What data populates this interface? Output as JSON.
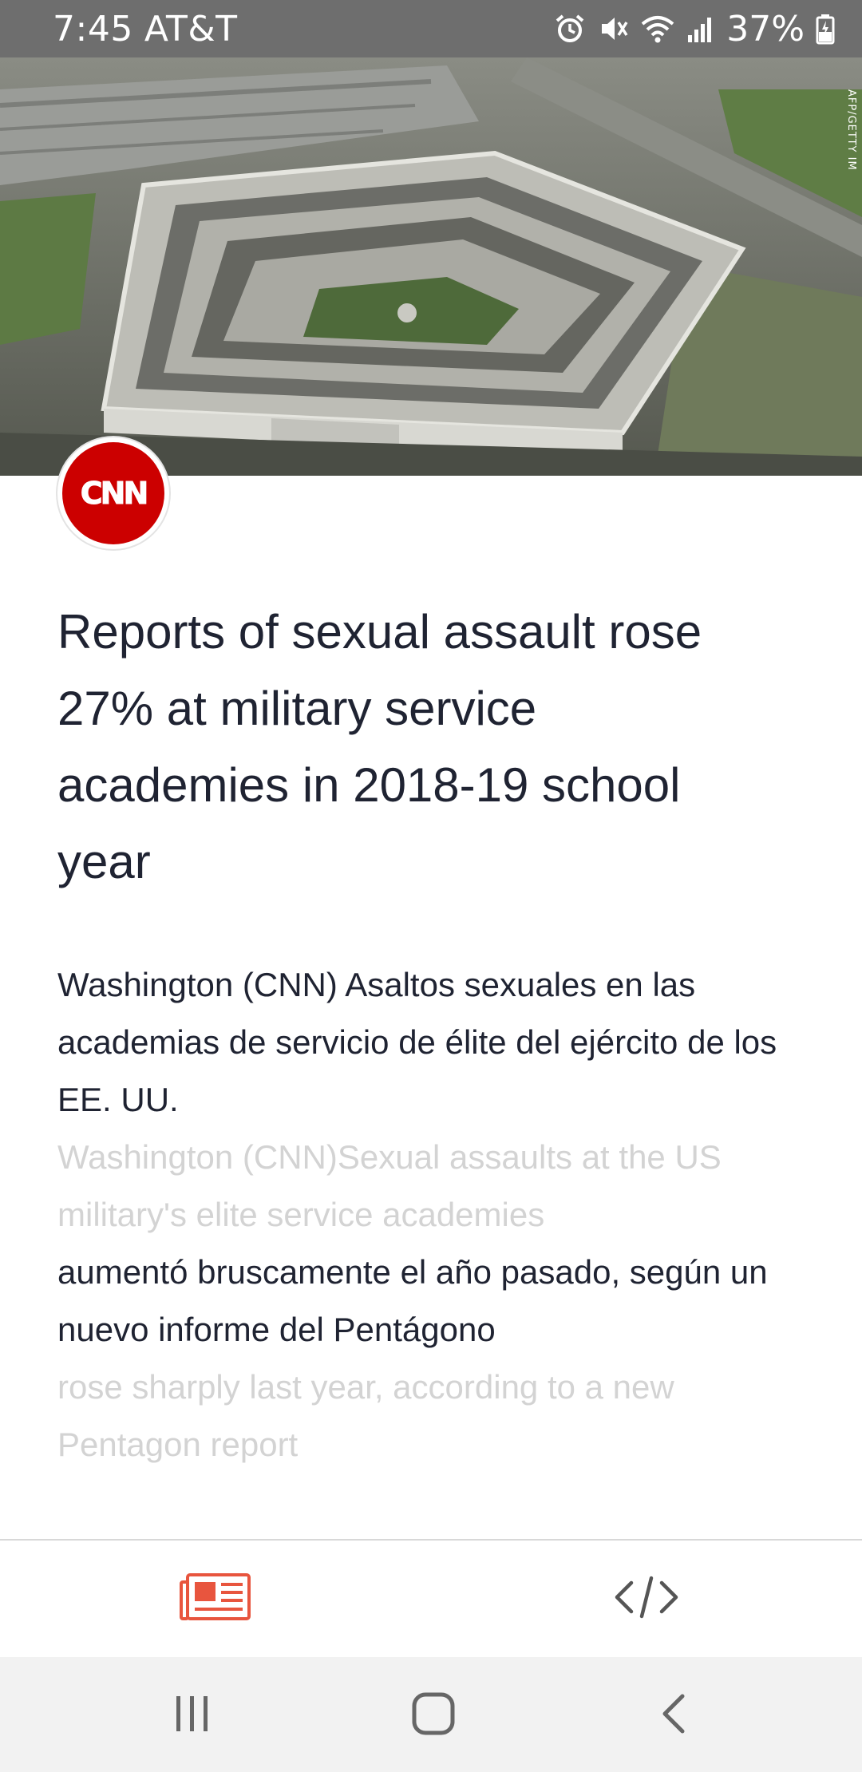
{
  "status_bar": {
    "time": "7:45",
    "carrier": "AT&T",
    "battery": "37%",
    "icons": [
      "alarm-icon",
      "mute-icon",
      "wifi-icon",
      "signal-icon",
      "battery-icon"
    ]
  },
  "hero": {
    "photo_credit": "AFP/GETTY IM",
    "image_subject": "pentagon-aerial-photo"
  },
  "source": {
    "logo_text": "CNN",
    "logo_color": "#cc0000"
  },
  "article": {
    "headline": "Reports of sexual assault rose 27% at military service academies in 2018-19 school year",
    "paragraphs": [
      {
        "translated": "Washington (CNN) Asaltos sexuales en las academias de servicio de élite del ejército de los EE. UU.",
        "original": "Washington (CNN)Sexual assaults at the US military's elite service academies"
      },
      {
        "translated": "aumentó bruscamente el año pasado, según un nuevo informe del Pentágono",
        "original": "rose sharply last year, according to a new Pentagon report"
      }
    ]
  },
  "toolbar": {
    "items": [
      "newspaper-icon",
      "code-icon"
    ],
    "accent_color": "#e8553e",
    "inactive_color": "#555555"
  },
  "nav_bar": {
    "items": [
      "recents-icon",
      "home-icon",
      "back-icon"
    ]
  }
}
